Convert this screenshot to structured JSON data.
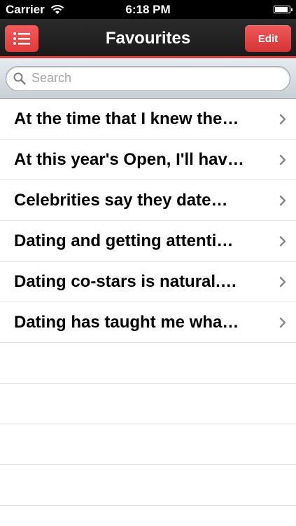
{
  "statusbar": {
    "carrier": "Carrier",
    "time": "6:18 PM"
  },
  "navbar": {
    "title": "Favourites",
    "edit_label": "Edit"
  },
  "search": {
    "placeholder": "Search"
  },
  "favourites": [
    "At the time that I knew the…",
    "At this year's Open, I'll hav…",
    "Celebrities say they date…",
    "Dating and getting attenti…",
    "Dating co-stars is natural.…",
    "Dating has taught me wha…"
  ],
  "colors": {
    "accent": "#e53a3a",
    "navbar": "#1f1f1f"
  },
  "icons": {
    "menu": "list-icon",
    "search": "magnifier-icon",
    "row": "chevron-right-icon"
  }
}
